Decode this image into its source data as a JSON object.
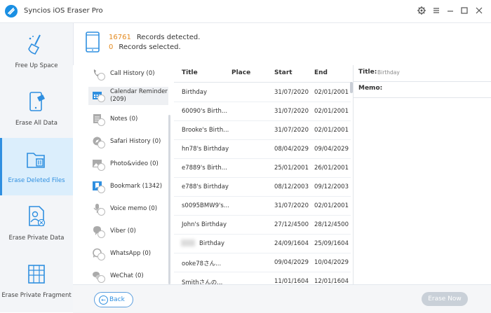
{
  "app": {
    "title": "Syncios iOS Eraser Pro"
  },
  "sidebar": {
    "items": [
      {
        "label": "Free Up Space",
        "icon": "broom-icon",
        "active": false
      },
      {
        "label": "Erase All Data",
        "icon": "phone-erase-icon",
        "active": false
      },
      {
        "label": "Erase Deleted Files",
        "icon": "folder-delete-icon",
        "active": true
      },
      {
        "label": "Erase Private Data",
        "icon": "user-file-icon",
        "active": false
      },
      {
        "label": "Erase Private Fragment",
        "icon": "building-icon",
        "active": false
      }
    ]
  },
  "summary": {
    "detected_count": "16761",
    "detected_label": "Records detected.",
    "selected_count": "0",
    "selected_label": "Records selected."
  },
  "categories": [
    {
      "label": "Call History (0)",
      "icon": "phone-icon"
    },
    {
      "label": "Calendar Reminder (209)",
      "icon": "calendar-icon",
      "active": true
    },
    {
      "label": "Notes (0)",
      "icon": "notes-icon"
    },
    {
      "label": "Safari History (0)",
      "icon": "compass-icon"
    },
    {
      "label": "Photo&video (0)",
      "icon": "photo-icon"
    },
    {
      "label": "Bookmark (1342)",
      "icon": "bookmark-icon"
    },
    {
      "label": "Voice memo (0)",
      "icon": "microphone-icon"
    },
    {
      "label": "Viber (0)",
      "icon": "viber-icon"
    },
    {
      "label": "WhatsApp (0)",
      "icon": "whatsapp-icon"
    },
    {
      "label": "WeChat (0)",
      "icon": "wechat-icon"
    }
  ],
  "table": {
    "headers": {
      "title": "Title",
      "place": "Place",
      "start": "Start",
      "end": "End"
    },
    "rows": [
      {
        "title": "Birthday",
        "start": "31/07/2020",
        "end": "02/01/2001"
      },
      {
        "title": "60090's Birth...",
        "start": "31/07/2020",
        "end": "02/01/2001"
      },
      {
        "title": "Brooke's Birth...",
        "start": "31/07/2020",
        "end": "02/01/2001"
      },
      {
        "title": "hn78's Birthday",
        "start": "08/04/2029",
        "end": "09/04/2029"
      },
      {
        "title": "e7889's Birth...",
        "start": "25/01/2001",
        "end": "26/01/2001"
      },
      {
        "title": "e788's Birthday",
        "start": "08/12/2003",
        "end": "09/12/2003"
      },
      {
        "title": "s0095BMW9's...",
        "start": "31/07/2020",
        "end": "02/01/2001"
      },
      {
        "title": "John's Birthday",
        "start": "27/12/4500",
        "end": "28/12/4500"
      },
      {
        "title": "Birthday",
        "start": "24/09/1604",
        "end": "25/09/1604",
        "blurred": true
      },
      {
        "title": "ooke78さん...",
        "start": "09/04/2029",
        "end": "10/04/2029"
      },
      {
        "title": "Smithさんの...",
        "start": "11/01/1604",
        "end": "12/01/1604"
      }
    ]
  },
  "detail": {
    "title_label": "Title:",
    "title_value": "Birthday",
    "memo_label": "Memo:"
  },
  "footer": {
    "back_label": "Back",
    "erase_label": "Erase Now"
  },
  "colors": {
    "accent": "#2f8fe0",
    "count": "#e48a1f"
  }
}
